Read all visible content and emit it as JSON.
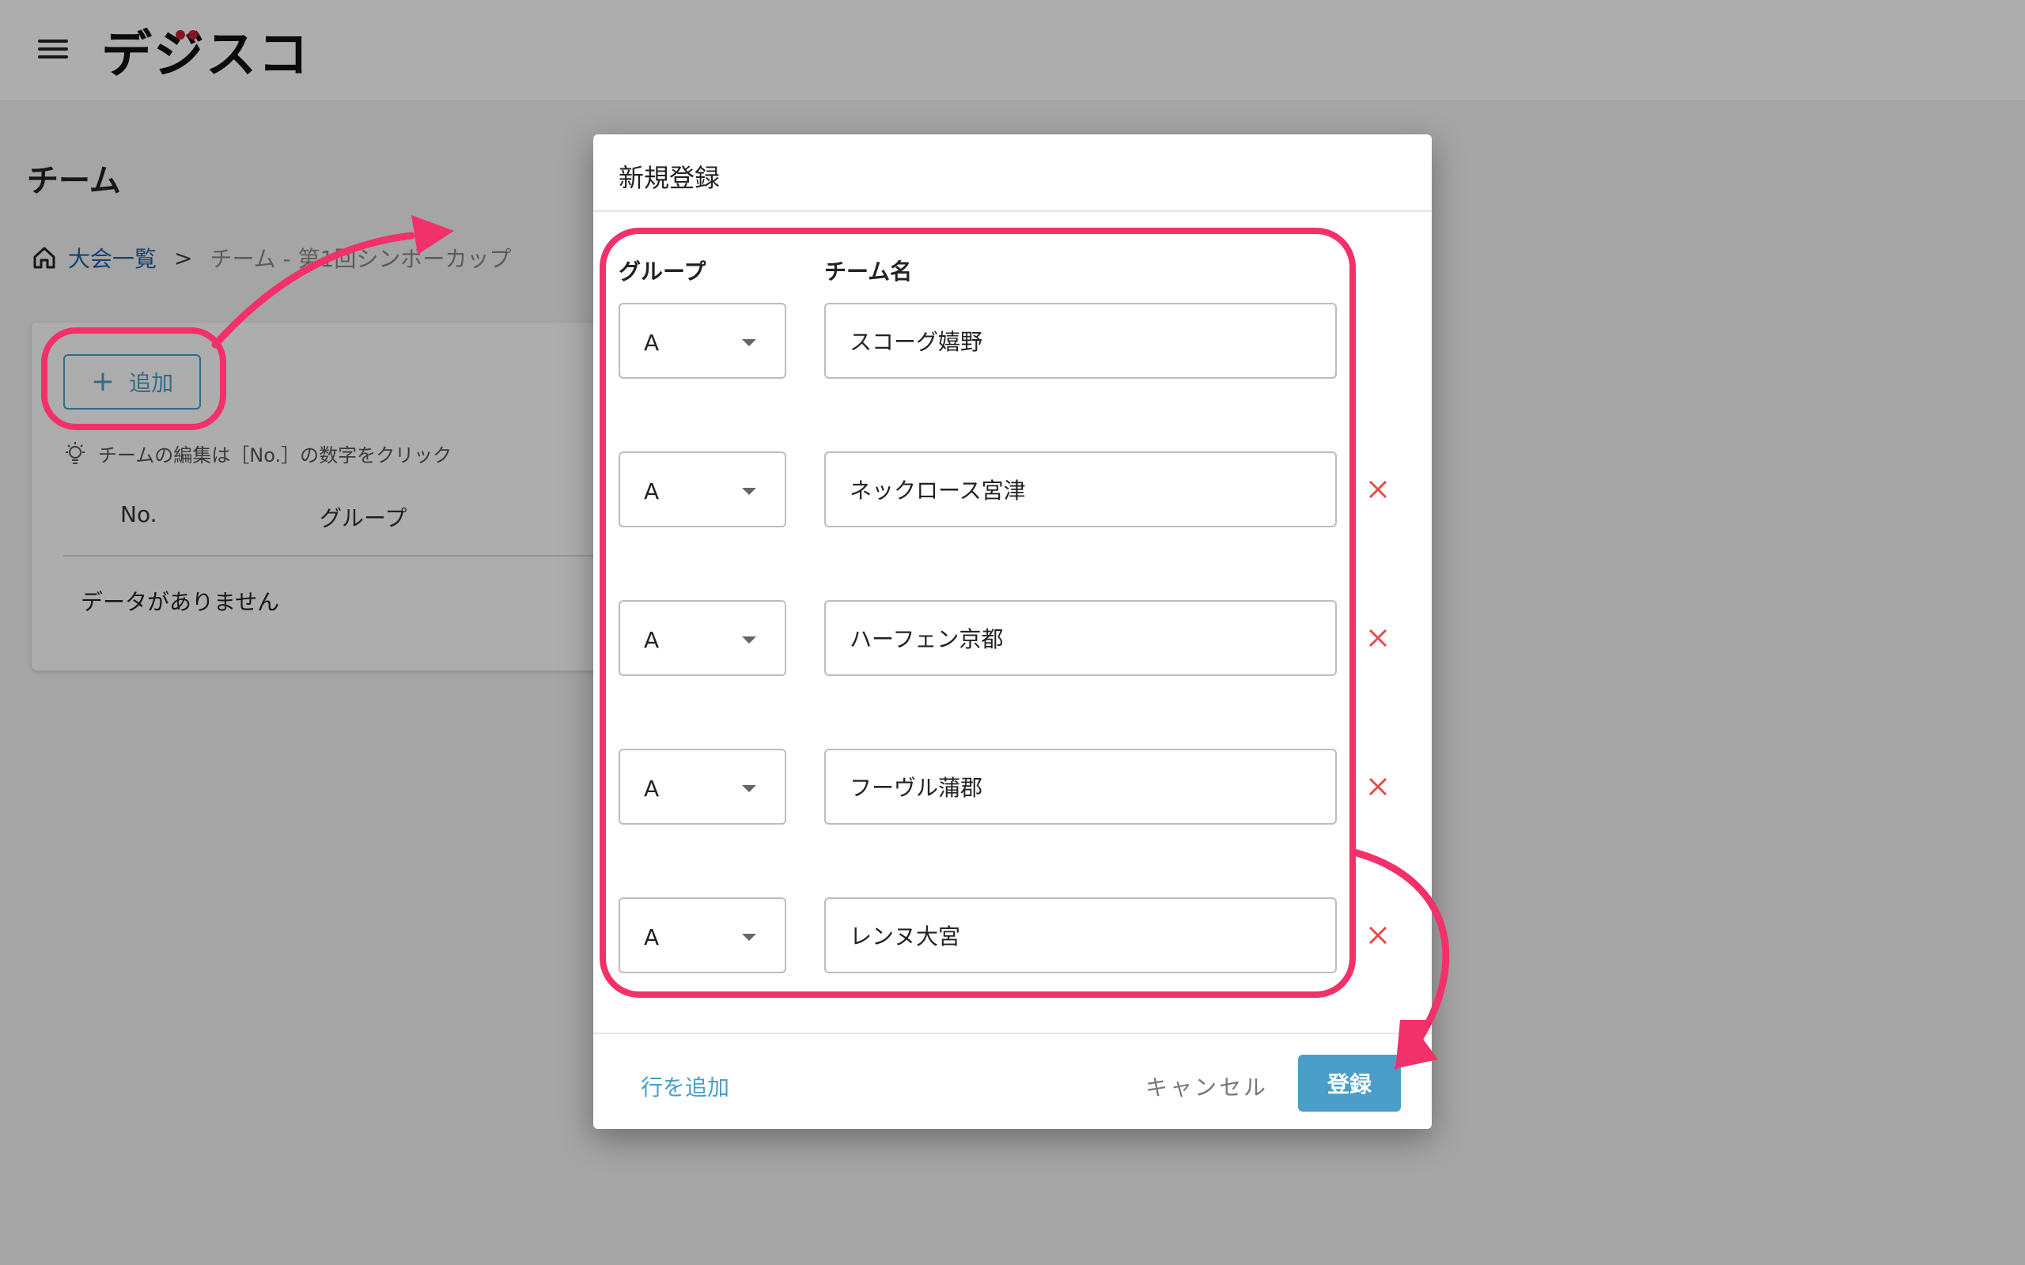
{
  "app": {
    "logo_text": "デジスコ"
  },
  "page": {
    "title": "チーム",
    "breadcrumb": {
      "home_label": "大会一覧",
      "separator": ">",
      "current": "チーム - 第1回シンボーカップ"
    },
    "add_button_label": "追加",
    "hint_text": "チームの編集は［No.］の数字をクリック",
    "table": {
      "headers": [
        "No.",
        "グループ"
      ],
      "empty_text": "データがありません"
    }
  },
  "dialog": {
    "title": "新規登録",
    "columns": {
      "group": "グループ",
      "team_name": "チーム名"
    },
    "rows": [
      {
        "group": "A",
        "team_name": "スコーグ嬉野"
      },
      {
        "group": "A",
        "team_name": "ネックロース宮津"
      },
      {
        "group": "A",
        "team_name": "ハーフェン京都"
      },
      {
        "group": "A",
        "team_name": "フーヴル蒲郡"
      },
      {
        "group": "A",
        "team_name": "レンヌ大宮"
      }
    ],
    "add_row_label": "行を追加",
    "cancel_label": "キャンセル",
    "submit_label": "登録"
  },
  "colors": {
    "accent": "#4a9ec9",
    "link": "#1f5fa8",
    "annotation": "#f2316b",
    "delete": "#e84a4a"
  }
}
